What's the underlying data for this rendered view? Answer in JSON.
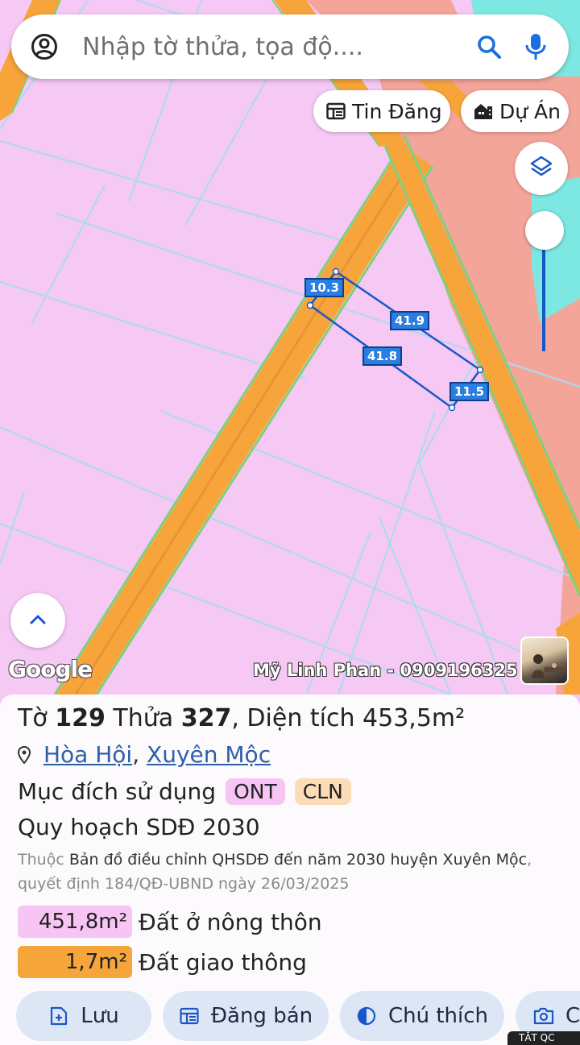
{
  "search": {
    "placeholder": "Nhập tờ thửa, tọa độ...."
  },
  "chips": {
    "tin_dang": "Tin Đăng",
    "du_an": "Dự Án"
  },
  "map": {
    "parcel_dimensions": {
      "top": "10.3",
      "right_long": "41.9",
      "left_long": "41.8",
      "bottom": "11.5"
    },
    "attribution": "Google",
    "watermark": "Mỹ Linh Phan - 0909196325",
    "colors": {
      "residential": "#f6c8f4",
      "road": "#f7a53a",
      "road_edge": "#7fd07a",
      "commercial": "#f4a59a",
      "water": "#7de8e2",
      "parcel_outline": "#1a56c9"
    }
  },
  "parcel": {
    "to_label": "Tờ",
    "to_value": "129",
    "thua_label": "Thửa",
    "thua_value": "327",
    "area_label": "Diện tích",
    "area_value": "453,5m²",
    "commune": "Hòa Hội",
    "district": "Xuyên Mộc",
    "purpose_label": "Mục đích sử dụng",
    "tags": [
      "ONT",
      "CLN"
    ]
  },
  "plan": {
    "title": "Quy hoạch SDĐ 2030",
    "prefix": "Thuộc",
    "map_name": "Bản đồ điều chỉnh QHSDĐ đến năm 2030 huyện Xuyên Mộc",
    "decision": ", quyết định 184/QĐ-UBND ngày 26/03/2025",
    "areas": [
      {
        "value": "451,8m²",
        "label": "Đất ở nông thôn",
        "color": "#f7c5f4"
      },
      {
        "value": "1,7m²",
        "label": "Đất giao thông",
        "color": "#f5a53a"
      }
    ]
  },
  "actions": {
    "save": "Lưu",
    "post": "Đăng bán",
    "legend": "Chú thích",
    "more": "C"
  },
  "footer_badge": "TẮT QC"
}
